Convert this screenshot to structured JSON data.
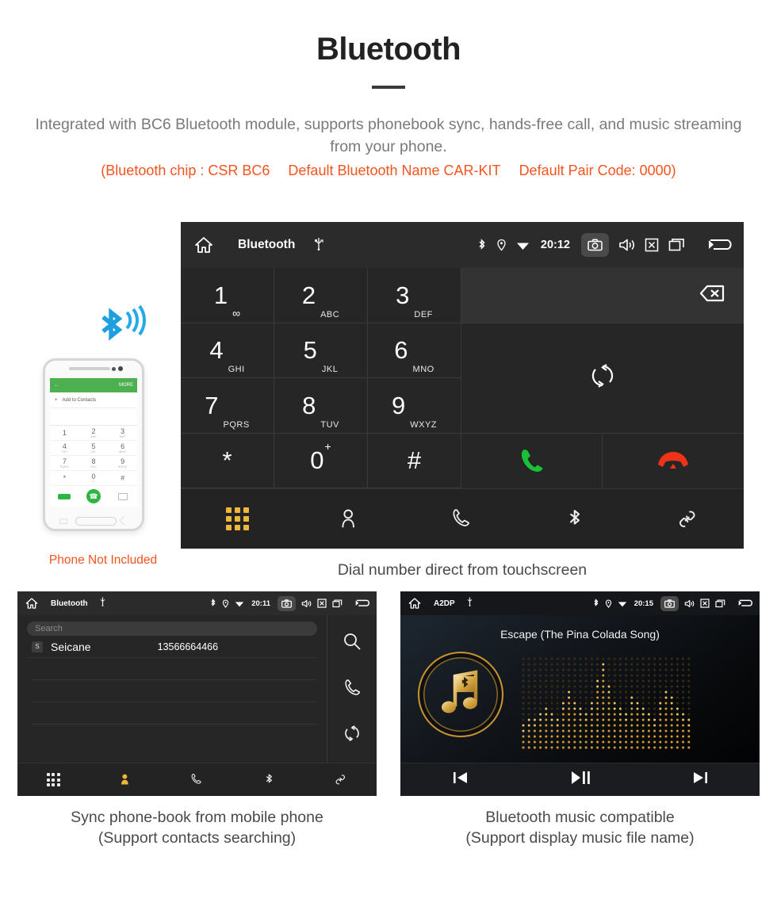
{
  "header": {
    "title": "Bluetooth",
    "description": "Integrated with BC6 Bluetooth module, supports phonebook sync, hands-free call, and music streaming from your phone.",
    "spec_open": "(Bluetooth chip : CSR BC6",
    "spec_name": "Default Bluetooth Name CAR-KIT",
    "spec_pair": "Default Pair Code: 0000)",
    "accent_color": "#f4541f",
    "body_color": "#7a7a7a"
  },
  "phone_mockup": {
    "topbar_more": "MORE",
    "add_to_contacts": "Add to Contacts",
    "keys": [
      {
        "num": "1",
        "sub": ""
      },
      {
        "num": "2",
        "sub": "ABC"
      },
      {
        "num": "3",
        "sub": "DEF"
      },
      {
        "num": "4",
        "sub": "GHI"
      },
      {
        "num": "5",
        "sub": "JKL"
      },
      {
        "num": "6",
        "sub": "MNO"
      },
      {
        "num": "7",
        "sub": "PQRS"
      },
      {
        "num": "8",
        "sub": "TUV"
      },
      {
        "num": "9",
        "sub": "WXYZ"
      },
      {
        "num": "*",
        "sub": ""
      },
      {
        "num": "0",
        "sub": "+"
      },
      {
        "num": "#",
        "sub": ""
      }
    ],
    "caption": "Phone Not Included",
    "caption_color": "#f4541f",
    "signal_icon": "bluetooth-signal-icon",
    "signal_color": "#1e9fe0"
  },
  "dialer": {
    "statusbar": {
      "home_icon": "home-icon",
      "title": "Bluetooth",
      "usb_icon": "usb-icon",
      "bluetooth_icon": "bluetooth-icon",
      "location_icon": "location-pin-icon",
      "wifi_icon": "wifi-icon",
      "time": "20:12",
      "camera_icon": "camera-icon",
      "volume_icon": "volume-icon",
      "close_icon": "close-box-icon",
      "recents_icon": "recent-apps-icon",
      "back_icon": "back-arrow-icon"
    },
    "display_value": "",
    "delete_icon": "backspace-icon",
    "sync_icon": "sync-icon",
    "call_icon": "call-icon",
    "endcall_icon": "end-call-icon",
    "call_color": "#19c137",
    "endcall_color": "#ee3318",
    "keys": [
      {
        "num": "1",
        "sub": "",
        "voicemail": true
      },
      {
        "num": "2",
        "sub": "ABC"
      },
      {
        "num": "3",
        "sub": "DEF"
      },
      {
        "num": "4",
        "sub": "GHI"
      },
      {
        "num": "5",
        "sub": "JKL"
      },
      {
        "num": "6",
        "sub": "MNO"
      },
      {
        "num": "7",
        "sub": "PQRS"
      },
      {
        "num": "8",
        "sub": "TUV"
      },
      {
        "num": "9",
        "sub": "WXYZ"
      },
      {
        "num": "*",
        "sub": ""
      },
      {
        "num": "0",
        "sub": "+"
      },
      {
        "num": "#",
        "sub": ""
      }
    ],
    "nav": [
      {
        "name": "keypad-tab",
        "icon": "keypad-grid-icon",
        "active": true
      },
      {
        "name": "contacts-tab",
        "icon": "person-icon",
        "active": false
      },
      {
        "name": "calllog-tab",
        "icon": "handset-icon",
        "active": false
      },
      {
        "name": "bluetooth-tab",
        "icon": "bluetooth-icon",
        "active": false
      },
      {
        "name": "link-tab",
        "icon": "link-icon",
        "active": false
      }
    ],
    "active_color": "#f0b63c",
    "caption": "Dial number direct from touchscreen"
  },
  "phonebook": {
    "statusbar": {
      "home_icon": "home-icon",
      "title": "Bluetooth",
      "usb_icon": "usb-icon",
      "time": "20:11",
      "camera_icon": "camera-icon"
    },
    "search_placeholder": "Search",
    "search_value": "",
    "contacts": [
      {
        "initial": "S",
        "name": "Seicane",
        "number": "13566664466"
      }
    ],
    "empty_rows": 3,
    "side_actions": [
      {
        "name": "search-action",
        "icon": "search-icon"
      },
      {
        "name": "call-action",
        "icon": "handset-icon"
      },
      {
        "name": "sync-action",
        "icon": "sync-icon"
      }
    ],
    "nav": [
      {
        "name": "keypad-tab",
        "icon": "keypad-grid-icon",
        "active": false
      },
      {
        "name": "contacts-tab",
        "icon": "person-icon",
        "active": true
      },
      {
        "name": "calllog-tab",
        "icon": "handset-icon",
        "active": false
      },
      {
        "name": "bluetooth-tab",
        "icon": "bluetooth-icon",
        "active": false
      },
      {
        "name": "link-tab",
        "icon": "link-icon",
        "active": false
      }
    ],
    "caption_line1": "Sync phone-book from mobile phone",
    "caption_line2": "(Support contacts searching)"
  },
  "a2dp": {
    "statusbar": {
      "home_icon": "home-icon",
      "title": "A2DP",
      "usb_icon": "usb-icon",
      "time": "20:15",
      "camera_icon": "camera-icon"
    },
    "track_title": "Escape (The Pina Colada Song)",
    "album_icon": "music-note-bluetooth-icon",
    "gold_color": "#c9932f",
    "controls": [
      {
        "name": "previous-button",
        "icon": "skip-previous-icon"
      },
      {
        "name": "play-pause-button",
        "icon": "play-pause-icon"
      },
      {
        "name": "next-button",
        "icon": "skip-next-icon"
      }
    ],
    "caption_line1": "Bluetooth music compatible",
    "caption_line2": "(Support display music file name)"
  }
}
